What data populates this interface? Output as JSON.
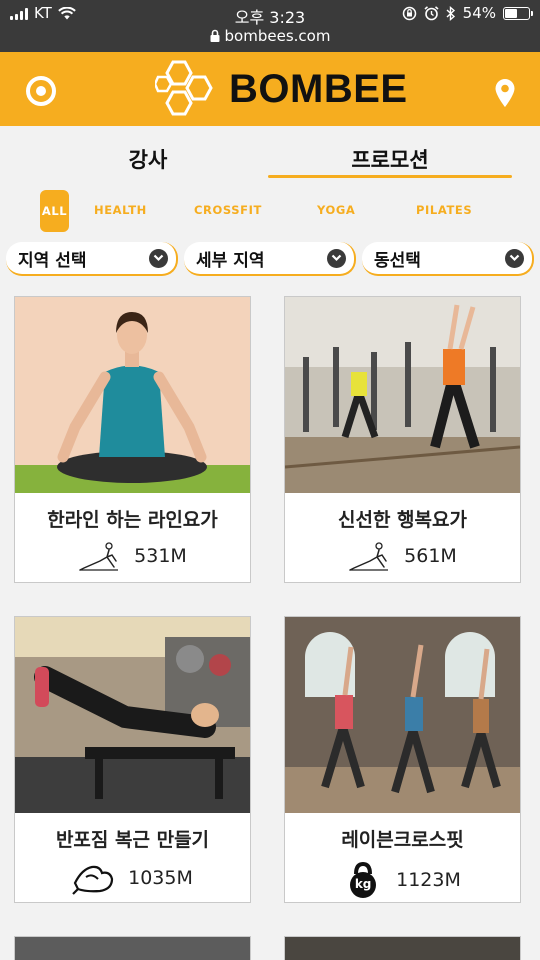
{
  "status_bar": {
    "carrier": "KT",
    "time": "오후 3:23",
    "url": "bombees.com",
    "battery": "54%",
    "battery_level": 0.54
  },
  "header": {
    "brand": "BOMBEE",
    "left_icon": "target-icon",
    "right_icon": "map-pin-icon",
    "accent_color": "#f6ad1f"
  },
  "tabs": [
    {
      "label": "강사",
      "active": false
    },
    {
      "label": "프로모션",
      "active": true
    }
  ],
  "categories": [
    {
      "label": "ALL",
      "active": true
    },
    {
      "label": "HEALTH",
      "active": false
    },
    {
      "label": "CROSSFIT",
      "active": false
    },
    {
      "label": "YOGA",
      "active": false
    },
    {
      "label": "PILATES",
      "active": false
    }
  ],
  "filters": [
    {
      "label": "지역 선택"
    },
    {
      "label": "세부 지역"
    },
    {
      "label": "동선택"
    }
  ],
  "cards": [
    {
      "title": "한라인 하는 라인요가",
      "distance": "531M",
      "icon": "yoga-pose-icon"
    },
    {
      "title": "신선한 행복요가",
      "distance": "561M",
      "icon": "yoga-pose-icon"
    },
    {
      "title": "반포짐 복근 만들기",
      "distance": "1035M",
      "icon": "muscle-arm-icon"
    },
    {
      "title": "레이븐크로스핏",
      "distance": "1123M",
      "icon": "kettlebell-icon",
      "icon_text": "kg"
    }
  ]
}
